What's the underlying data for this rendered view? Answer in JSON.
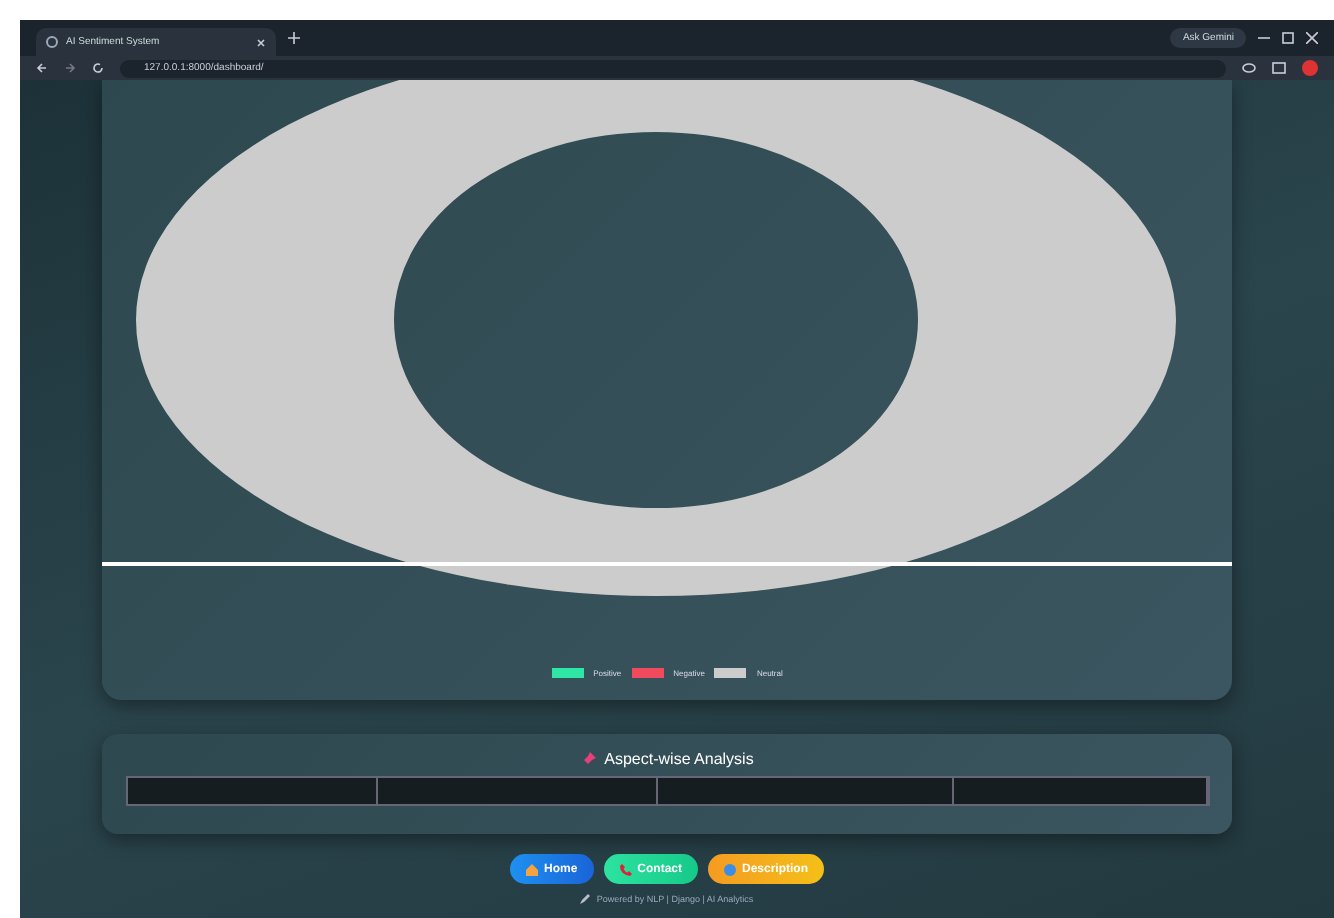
{
  "browser": {
    "tab_title": "AI Sentiment System",
    "url": "127.0.0.1:8000/dashboard/",
    "ask_button": "Ask Gemini"
  },
  "chart": {
    "legend": [
      {
        "label": "Positive",
        "color": "#2ee6a6"
      },
      {
        "label": "Negative",
        "color": "#ef4a5e"
      },
      {
        "label": "Neutral",
        "color": "#cccccc"
      }
    ]
  },
  "aspect_section": {
    "title": "Aspect-wise Analysis"
  },
  "nav_buttons": [
    {
      "label": "Home",
      "kind": "home"
    },
    {
      "label": "Contact",
      "kind": "contact"
    },
    {
      "label": "Description",
      "kind": "description"
    }
  ],
  "footer": "Powered by NLP | Django | AI Analytics"
}
